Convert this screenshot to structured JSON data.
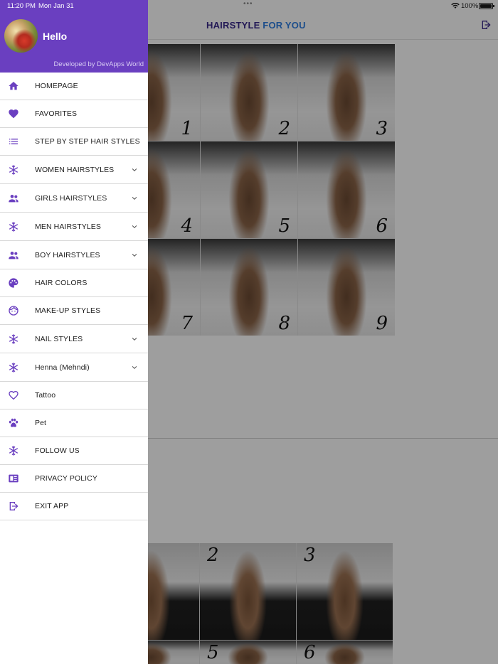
{
  "status_bar": {
    "time": "11:20 PM",
    "date": "Mon Jan 31",
    "battery": "100%"
  },
  "app": {
    "title_part1": "HAIRSTYLE",
    "title_part2": "FOR YOU",
    "colors": {
      "title_dark": "#3a2a8c",
      "title_blue": "#2f7fe0"
    },
    "grid1_numbers": [
      "1",
      "2",
      "3",
      "4",
      "5",
      "6",
      "7",
      "8",
      "9"
    ],
    "grid2_numbers": [
      "2",
      "3",
      "5",
      "6"
    ]
  },
  "drawer": {
    "greeting": "Hello",
    "credit": "Developed by DevApps World",
    "accent_color": "#6a3fc0",
    "items": [
      {
        "label": "HOMEPAGE",
        "icon": "home-icon",
        "expandable": false
      },
      {
        "label": "FAVORITES",
        "icon": "heart-icon",
        "expandable": false
      },
      {
        "label": "STEP BY STEP HAIR STYLES",
        "icon": "list-icon",
        "expandable": false
      },
      {
        "label": "WOMEN HAIRSTYLES",
        "icon": "snowflake-icon",
        "expandable": true
      },
      {
        "label": "GIRLS HAIRSTYLES",
        "icon": "people-icon",
        "expandable": true
      },
      {
        "label": "MEN HAIRSTYLES",
        "icon": "snowflake-icon",
        "expandable": true
      },
      {
        "label": "BOY HAIRSTYLES",
        "icon": "people-icon",
        "expandable": true
      },
      {
        "label": "HAIR COLORS",
        "icon": "palette-icon",
        "expandable": false
      },
      {
        "label": "MAKE-UP STYLES",
        "icon": "face-icon",
        "expandable": false
      },
      {
        "label": "NAIL STYLES",
        "icon": "snowflake-icon",
        "expandable": true
      },
      {
        "label": "Henna (Mehndi)",
        "icon": "snowflake-icon",
        "expandable": true
      },
      {
        "label": "Tattoo",
        "icon": "heart-outline-icon",
        "expandable": false
      },
      {
        "label": "Pet",
        "icon": "paw-icon",
        "expandable": false
      },
      {
        "label": "FOLLOW US",
        "icon": "snowflake-icon",
        "expandable": false
      },
      {
        "label": "PRIVACY POLICY",
        "icon": "policy-icon",
        "expandable": false
      },
      {
        "label": "EXIT APP",
        "icon": "exit-icon",
        "expandable": false
      }
    ]
  }
}
